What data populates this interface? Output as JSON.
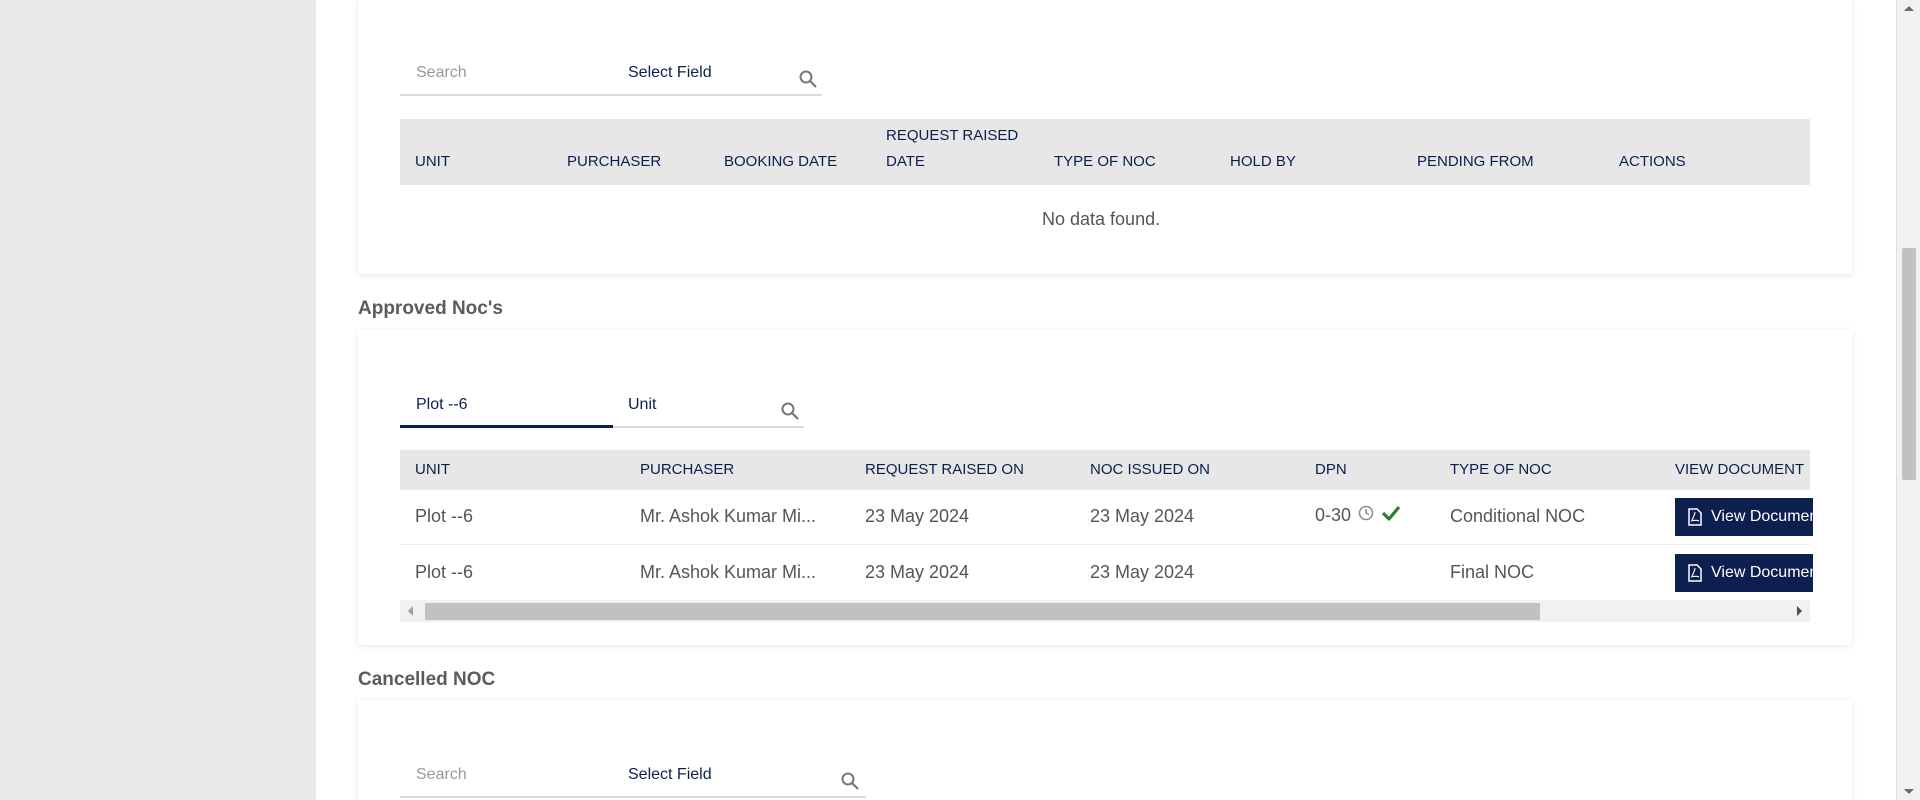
{
  "pending": {
    "search": {
      "placeholder": "Search",
      "field": "Select Field",
      "icon": "search-icon"
    },
    "columns": [
      "UNIT",
      "PURCHASER",
      "BOOKING DATE",
      "REQUEST RAISED",
      "DATE",
      "TYPE OF NOC",
      "HOLD BY",
      "PENDING FROM",
      "ACTIONS"
    ],
    "empty_text": "No data found."
  },
  "approved": {
    "title": "Approved Noc's",
    "search": {
      "value": "Plot --6",
      "field": "Unit",
      "icon": "search-icon"
    },
    "columns": [
      "UNIT",
      "PURCHASER",
      "REQUEST RAISED ON",
      "NOC ISSUED ON",
      "DPN",
      "TYPE OF NOC",
      "VIEW DOCUMENT"
    ],
    "rows": [
      {
        "unit": "Plot --6",
        "purchaser": "Mr. Ashok Kumar Mi...",
        "raised": "23 May 2024",
        "issued": "23 May 2024",
        "dpn": "0-30",
        "type": "Conditional NOC",
        "action": "View Document"
      },
      {
        "unit": "Plot --6",
        "purchaser": "Mr. Ashok Kumar Mi...",
        "raised": "23 May 2024",
        "issued": "23 May 2024",
        "dpn": "",
        "type": "Final NOC",
        "action": "View Document"
      }
    ],
    "scroll_fraction": 0.82
  },
  "cancelled": {
    "title": "Cancelled NOC",
    "search": {
      "placeholder": "Search",
      "field": "Select Field",
      "icon": "search-icon"
    }
  },
  "colors": {
    "primary": "#0d1f4f",
    "header_bg": "#e7e7e7",
    "success": "#2e7d32"
  }
}
